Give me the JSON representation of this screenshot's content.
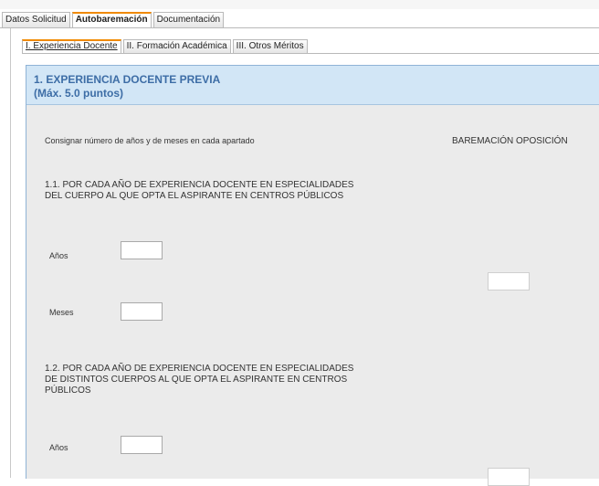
{
  "main_tabs": [
    "Datos Solicitud",
    "Autobaremación",
    "Documentación"
  ],
  "sub_tabs": [
    "I. Experiencia Docente",
    "II. Formación Académica",
    "III. Otros Méritos"
  ],
  "section": {
    "title": "1. EXPERIENCIA DOCENTE PREVIA",
    "subtitle": "(Máx. 5.0 puntos)"
  },
  "instruction": "Consignar número de años y de meses en cada apartado",
  "column_header": "BAREMACIÓN OPOSICIÓN",
  "items": [
    {
      "lines": [
        "1.1. POR CADA AÑO DE EXPERIENCIA DOCENTE EN ESPECIALIDADES",
        "DEL CUERPO AL QUE OPTA EL ASPIRANTE EN CENTROS PÚBLICOS"
      ],
      "years_label": "Años",
      "months_label": "Meses",
      "years_value": "",
      "months_value": "",
      "score_value": ""
    },
    {
      "lines": [
        "1.2. POR CADA AÑO DE EXPERIENCIA DOCENTE EN ESPECIALIDADES",
        "DE DISTINTOS CUERPOS AL QUE OPTA EL ASPIRANTE EN CENTROS",
        "PÚBLICOS"
      ],
      "years_label": "Años",
      "years_value": "",
      "score_value": ""
    }
  ]
}
